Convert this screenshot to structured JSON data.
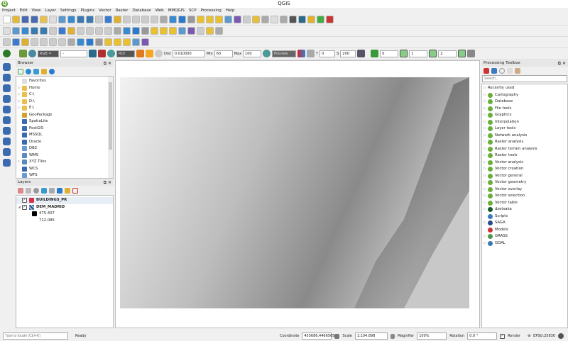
{
  "window": {
    "title": "QGIS",
    "logo": "Q"
  },
  "menu": [
    "Project",
    "Edit",
    "View",
    "Layer",
    "Settings",
    "Plugins",
    "Vector",
    "Raster",
    "Database",
    "Web",
    "MMQGIS",
    "SCP",
    "Processing",
    "Help"
  ],
  "scp_toolbar": {
    "rgb_label": "RGB =",
    "rgb_value": "-",
    "roi_label": "ROI",
    "dist_label": "Dist",
    "dist_value": "0,010000",
    "min_label": "Min",
    "min_value": "60",
    "max_label": "Max",
    "max_value": "100",
    "preview_label": "Preview",
    "t_label": "T",
    "t_value": "0",
    "s_label": "S",
    "s_value": "200",
    "band_values": [
      "0",
      "1",
      "2"
    ]
  },
  "browser": {
    "title": "Browser",
    "items": [
      {
        "label": "Favorites",
        "icon": "star-icon",
        "expandable": false
      },
      {
        "label": "Home",
        "icon": "folder-icon",
        "expandable": true
      },
      {
        "label": "C:\\",
        "icon": "folder-icon",
        "expandable": true
      },
      {
        "label": "D:\\",
        "icon": "folder-icon",
        "expandable": true
      },
      {
        "label": "E:\\",
        "icon": "folder-icon",
        "expandable": true
      },
      {
        "label": "GeoPackage",
        "icon": "geopackage-icon",
        "expandable": false
      },
      {
        "label": "SpatiaLite",
        "icon": "spatialite-icon",
        "expandable": false
      },
      {
        "label": "PostGIS",
        "icon": "postgis-icon",
        "expandable": false
      },
      {
        "label": "MSSQL",
        "icon": "mssql-icon",
        "expandable": false
      },
      {
        "label": "Oracle",
        "icon": "oracle-icon",
        "expandable": false
      },
      {
        "label": "DB2",
        "icon": "db2-icon",
        "expandable": false
      },
      {
        "label": "WMS",
        "icon": "wms-icon",
        "expandable": false
      },
      {
        "label": "XYZ Tiles",
        "icon": "xyz-icon",
        "expandable": true
      },
      {
        "label": "WCS",
        "icon": "wcs-icon",
        "expandable": false
      },
      {
        "label": "WFS",
        "icon": "wfs-icon",
        "expandable": false
      }
    ]
  },
  "layers": {
    "title": "Layers",
    "items": [
      {
        "label": "BUILDINGS_PR",
        "color": "#d6304a"
      },
      {
        "label": "DEM_MADRID"
      }
    ],
    "legend": {
      "max": "475.407",
      "min": "712.085"
    }
  },
  "processing": {
    "title": "Processing Toolbox",
    "search_placeholder": "Search...",
    "items": [
      "Recently used",
      "Cartography",
      "Database",
      "File tools",
      "Graphics",
      "Interpolation",
      "Layer tools",
      "Network analysis",
      "Raster analysis",
      "Raster terrain analysis",
      "Raster tools",
      "Vector analysis",
      "Vector creation",
      "Vector general",
      "Vector geometry",
      "Vector overlay",
      "Vector selection",
      "Vector table",
      "dzetsaka",
      "Scripts",
      "SAGA",
      "Models",
      "GRASS",
      "GDAL"
    ]
  },
  "status": {
    "locate_placeholder": "Type to locate (Ctrl+K)",
    "message": "Ready",
    "coordinate_label": "Coordinate",
    "coordinate": "455686,4466565",
    "scale_label": "Scale",
    "scale": "1:104.898",
    "magnifier_label": "Magnifier",
    "magnifier": "100%",
    "rotation_label": "Rotation",
    "rotation": "0.0 °",
    "render_label": "Render",
    "render_checked": true,
    "crs": "EPSG:25830"
  },
  "colors": {
    "buildings": "#ff1a1a",
    "accent": "#5a9e2f"
  }
}
